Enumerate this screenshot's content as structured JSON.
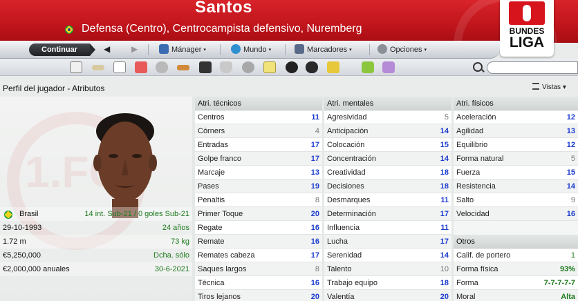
{
  "header": {
    "player_name": "Santos",
    "description": "Defensa (Centro), Centrocampista defensivo, Nuremberg",
    "league_logo": {
      "line1": "BUNDES",
      "line2": "LIGA"
    }
  },
  "toolbar": {
    "continue_label": "Continuar",
    "manager_label": "Mánager",
    "world_label": "Mundo",
    "bookmarks_label": "Marcadores",
    "options_label": "Opciones",
    "caret": "▾",
    "back": "◀",
    "forward": "▶"
  },
  "section": {
    "title": "Perfil del jugador - Atributos",
    "views_label": "Vistas",
    "views_caret": "▾"
  },
  "profile": {
    "nationality": "Brasil",
    "caps": "14 int. Sub-21 / 0 goles Sub-21",
    "dob": "29-10-1993",
    "age": "24 años",
    "height": "1.72 m",
    "weight": "73 kg",
    "value": "€5,250,000",
    "foot": "Dcha. sólo",
    "wage": "€2,000,000 anuales",
    "contract_end": "30-6-2021"
  },
  "technical": {
    "title": "Atri. técnicos",
    "rows": [
      {
        "label": "Centros",
        "value": "11"
      },
      {
        "label": "Córners",
        "value": "4"
      },
      {
        "label": "Entradas",
        "value": "17"
      },
      {
        "label": "Golpe franco",
        "value": "17"
      },
      {
        "label": "Marcaje",
        "value": "13"
      },
      {
        "label": "Pases",
        "value": "19"
      },
      {
        "label": "Penaltis",
        "value": "8"
      },
      {
        "label": "Primer Toque",
        "value": "20"
      },
      {
        "label": "Regate",
        "value": "16"
      },
      {
        "label": "Remate",
        "value": "16"
      },
      {
        "label": "Remates cabeza",
        "value": "17"
      },
      {
        "label": "Saques largos",
        "value": "8"
      },
      {
        "label": "Técnica",
        "value": "16"
      },
      {
        "label": "Tiros lejanos",
        "value": "20"
      }
    ]
  },
  "mental": {
    "title": "Atri. mentales",
    "rows": [
      {
        "label": "Agresividad",
        "value": "5"
      },
      {
        "label": "Anticipación",
        "value": "14"
      },
      {
        "label": "Colocación",
        "value": "15"
      },
      {
        "label": "Concentración",
        "value": "14"
      },
      {
        "label": "Creatividad",
        "value": "18"
      },
      {
        "label": "Decisiones",
        "value": "18"
      },
      {
        "label": "Desmarques",
        "value": "11"
      },
      {
        "label": "Determinación",
        "value": "17"
      },
      {
        "label": "Influencia",
        "value": "11"
      },
      {
        "label": "Lucha",
        "value": "17"
      },
      {
        "label": "Serenidad",
        "value": "14"
      },
      {
        "label": "Talento",
        "value": "10"
      },
      {
        "label": "Trabajo equipo",
        "value": "18"
      },
      {
        "label": "Valentía",
        "value": "20"
      }
    ]
  },
  "physical": {
    "title": "Atri. físicos",
    "rows": [
      {
        "label": "Aceleración",
        "value": "12"
      },
      {
        "label": "Agilidad",
        "value": "13"
      },
      {
        "label": "Equilibrio",
        "value": "12"
      },
      {
        "label": "Forma natural",
        "value": "5"
      },
      {
        "label": "Fuerza",
        "value": "15"
      },
      {
        "label": "Resistencia",
        "value": "14"
      },
      {
        "label": "Salto",
        "value": "9"
      },
      {
        "label": "Velocidad",
        "value": "16"
      }
    ]
  },
  "others": {
    "title": "Otros",
    "rows": [
      {
        "label": "Calif. de portero",
        "value": "1"
      },
      {
        "label": "Forma física",
        "value": "93%"
      },
      {
        "label": "Forma",
        "value": "7-7-7-7-7"
      },
      {
        "label": "Moral",
        "value": "Alta"
      }
    ]
  },
  "colors": {
    "header_red": "#c0141b",
    "attr_high": "#1b3ccf",
    "attr_low": "#777777",
    "green_text": "#1c7a1c"
  }
}
